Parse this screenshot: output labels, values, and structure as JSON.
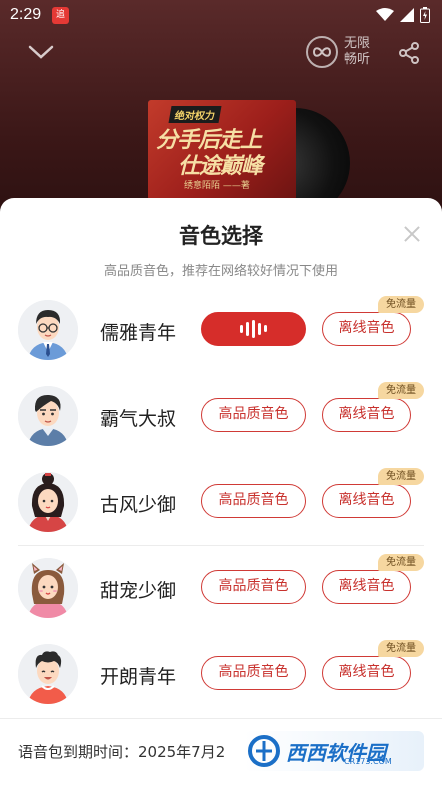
{
  "status_bar": {
    "time": "2:29",
    "app_badge": "追"
  },
  "player": {
    "unlimited_label": "无限畅听",
    "cover": {
      "tag": "绝对权力",
      "title_line1": "分手后走上",
      "title_line2": "仕途巅峰",
      "subtitle": "绣意陌陌 ——著"
    }
  },
  "sheet": {
    "title": "音色选择",
    "subtitle": "高品质音色，推荐在网络较好情况下使用",
    "hq_label": "高品质音色",
    "offline_label": "离线音色",
    "free_badge": "免流量",
    "voices": [
      {
        "name": "儒雅青年",
        "selected": true
      },
      {
        "name": "霸气大叔",
        "selected": false
      },
      {
        "name": "古风少御",
        "selected": false
      },
      {
        "name": "甜宠少御",
        "selected": false
      },
      {
        "name": "开朗青年",
        "selected": false
      }
    ],
    "footer_text": "语音包到期时间：2025年7月2"
  },
  "watermark": {
    "text": "西西软件园",
    "sub": "CR173.COM"
  },
  "colors": {
    "accent": "#d62d2a",
    "badge": "#f6d7a0"
  }
}
